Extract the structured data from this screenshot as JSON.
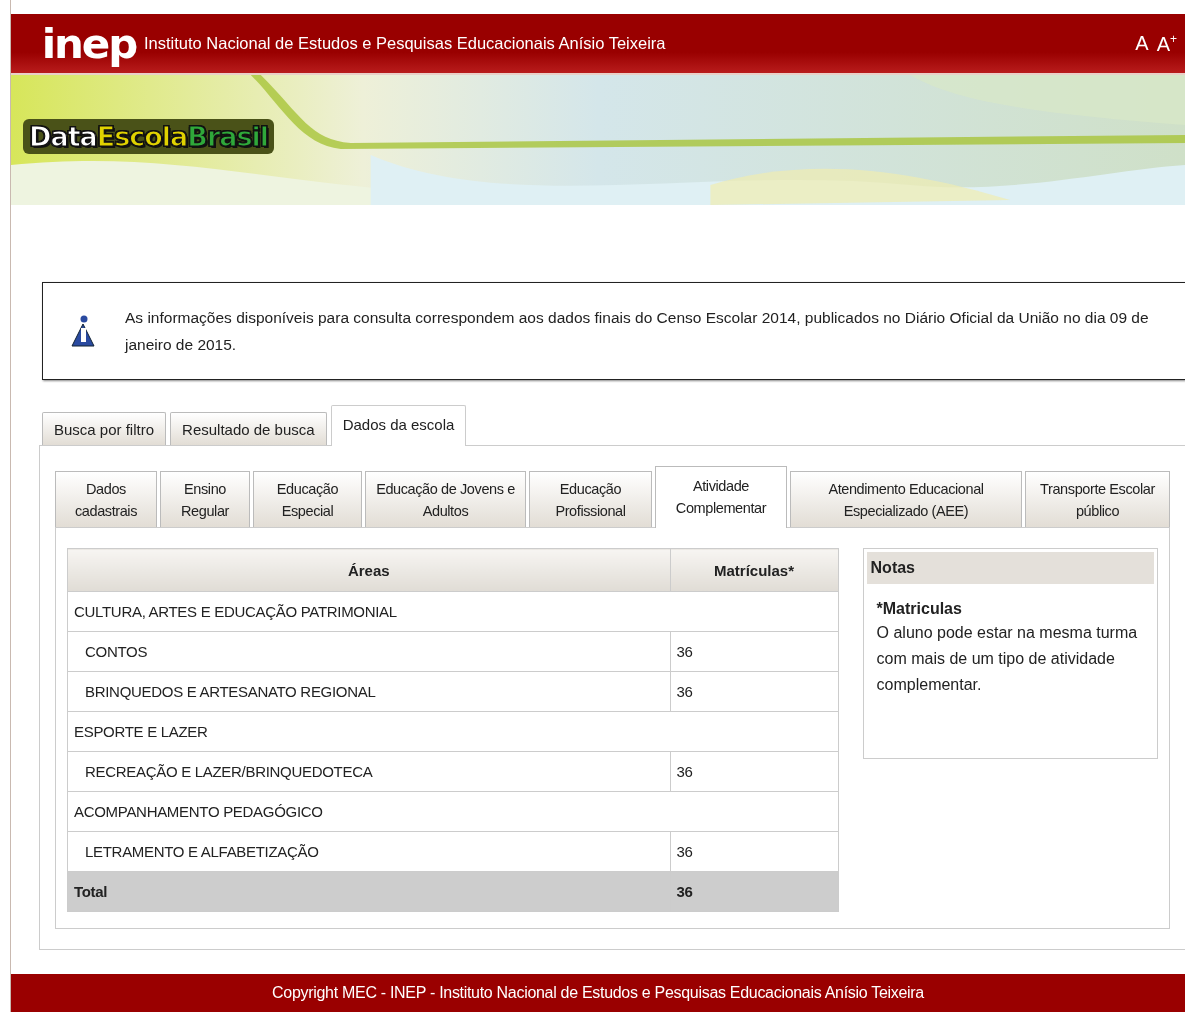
{
  "header": {
    "logo": "inep",
    "title": "Instituto Nacional de Estudos e Pesquisas Educacionais Anísio Teixeira",
    "font_controls": [
      "A",
      "A$^{+}$"
    ]
  },
  "banner": {
    "logo_parts": [
      {
        "text": "Data",
        "color": "#ffffff"
      },
      {
        "text": "Escola",
        "color": "#e0d200"
      },
      {
        "text": "Brasil",
        "color": "#2fa83a"
      }
    ]
  },
  "notice": {
    "text": "As informações disponíveis para consulta correspondem aos dados finais do Censo Escolar 2014, publicados no Diário Oficial da União no dia 09 de janeiro de 2015."
  },
  "tabs": [
    {
      "label": "Busca por filtro",
      "selected": false
    },
    {
      "label": "Resultado de busca",
      "selected": false
    },
    {
      "label": "Dados da escola",
      "selected": true
    }
  ],
  "subtabs": [
    {
      "label": "Dados cadastrais",
      "selected": false
    },
    {
      "label": "Ensino Regular",
      "selected": false
    },
    {
      "label": "Educação Especial",
      "selected": false
    },
    {
      "label": "Educação de Jovens e Adultos",
      "selected": false
    },
    {
      "label": "Educação Profissional",
      "selected": false
    },
    {
      "label": "Atividade Complementar",
      "selected": true
    },
    {
      "label": "Atendimento Educacional Especializado (AEE)",
      "selected": false
    },
    {
      "label": "Transporte Escolar público",
      "selected": false
    }
  ],
  "table": {
    "columns": [
      "Áreas",
      "Matrículas*"
    ],
    "rows": [
      {
        "kind": "group",
        "area": "CULTURA, ARTES E EDUCAÇÃO PATRIMONIAL"
      },
      {
        "kind": "item",
        "area": "CONTOS",
        "count": "36"
      },
      {
        "kind": "item",
        "area": "BRINQUEDOS E ARTESANATO REGIONAL",
        "count": "36"
      },
      {
        "kind": "group",
        "area": "ESPORTE E LAZER"
      },
      {
        "kind": "item",
        "area": "RECREAÇÃO E LAZER/BRINQUEDOTECA",
        "count": "36"
      },
      {
        "kind": "group",
        "area": "ACOMPANHAMENTO PEDAGÓGICO"
      },
      {
        "kind": "item",
        "area": "LETRAMENTO E ALFABETIZAÇÃO",
        "count": "36"
      },
      {
        "kind": "total",
        "area": "Total",
        "count": "36"
      }
    ]
  },
  "notes": {
    "title": "Notas",
    "heading": "*Matriculas",
    "text": "O aluno pode estar na mesma turma com mais de um tipo de atividade complementar."
  },
  "footer": {
    "text": "Copyright MEC - INEP - Instituto Nacional de Estudos e Pesquisas Educacionais Anísio Teixeira"
  }
}
